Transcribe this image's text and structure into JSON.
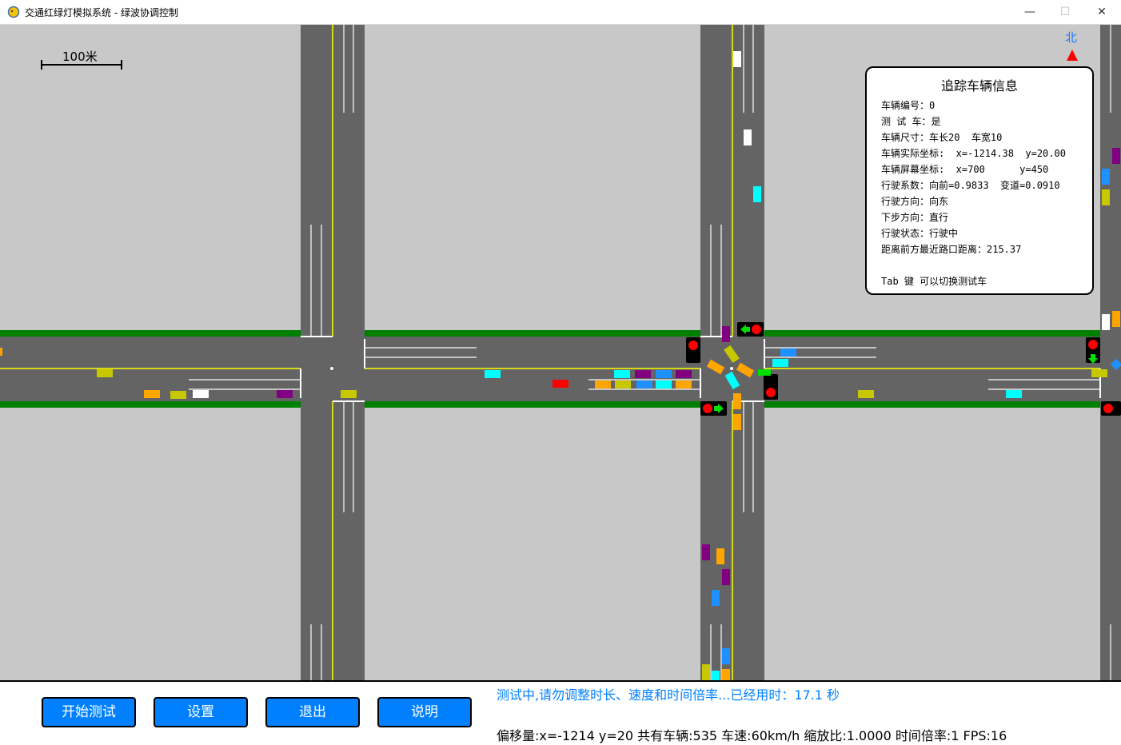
{
  "window": {
    "title": "交通红绿灯模拟系统 - 绿波协调控制",
    "minimize_glyph": "—",
    "maximize_glyph": "☐",
    "close_glyph": "✕"
  },
  "map": {
    "scale_label": "100米",
    "north_label": "北",
    "colors": {
      "grass": "#c8c8c8",
      "road": "#646464",
      "center_line": "#ffff00",
      "lane_line": "#ffffff",
      "median": "#008000",
      "north": "#1e78ff",
      "north_arrow": "#ff0000"
    }
  },
  "tracked_vehicle": {
    "title": "追踪车辆信息",
    "lines": [
      "车辆编号：0",
      "测 试 车：是",
      "车辆尺寸：车长20  车宽10",
      "车辆实际坐标:  x=-1214.38  y=20.00",
      "车辆屏幕坐标:  x=700      y=450",
      "行驶系数：向前=0.9833  变道=0.0910",
      "行驶方向：向东",
      "下步方向：直行",
      "行驶状态：行驶中",
      "距离前方最近路口距离：215.37",
      "",
      "Tab 键 可以切换测试车"
    ]
  },
  "controls": {
    "start_label": "开始测试",
    "settings_label": "设置",
    "exit_label": "退出",
    "help_label": "说明"
  },
  "status": {
    "message": "测试中,请勿调整时长、速度和时间倍率...已经用时：17.1 秒",
    "info": "偏移量:x=-1214 y=20 共有车辆:535  车速:60km/h 缩放比:1.0000 时间倍率:1 FPS:16"
  },
  "vehicle_colors": {
    "orange": "#ffa500",
    "purple": "#800080",
    "cyan": "#00ffff",
    "olive": "#c8c800",
    "blue": "#1e90ff",
    "white": "#ffffff",
    "red": "#ff0000"
  }
}
